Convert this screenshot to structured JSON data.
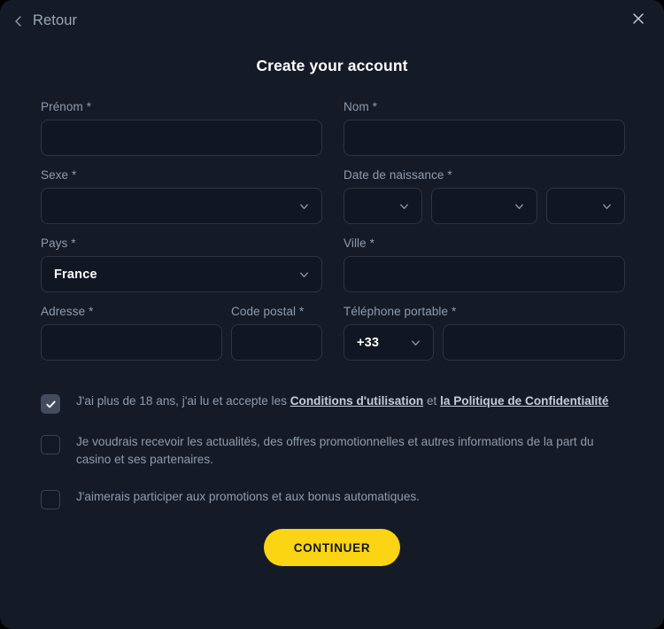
{
  "header": {
    "back_label": "Retour",
    "close_icon": "close-icon",
    "back_icon": "chevron-left-icon",
    "title": "Create your account"
  },
  "form": {
    "first_name": {
      "label": "Prénom *",
      "value": "",
      "placeholder": ""
    },
    "last_name": {
      "label": "Nom *",
      "value": "",
      "placeholder": ""
    },
    "sex": {
      "label": "Sexe *",
      "value": ""
    },
    "birth_date": {
      "label": "Date de naissance *",
      "day": "",
      "month": "",
      "year": ""
    },
    "country": {
      "label": "Pays *",
      "value": "France"
    },
    "city": {
      "label": "Ville *",
      "value": "",
      "placeholder": ""
    },
    "address": {
      "label": "Adresse *",
      "value": "",
      "placeholder": ""
    },
    "postal_code": {
      "label": "Code postal *",
      "value": "",
      "placeholder": ""
    },
    "mobile_phone": {
      "label": "Téléphone portable *",
      "prefix": "+33",
      "number": "",
      "placeholder": ""
    }
  },
  "consents": [
    {
      "checked": true,
      "text_before": "J'ai plus de 18 ans, j'ai lu et accepte les ",
      "link1": "Conditions d'utilisation",
      "text_middle": " et ",
      "link2": "la Politique de Confidentialité",
      "text_after": ""
    },
    {
      "checked": false,
      "text": "Je voudrais recevoir les actualités, des offres promotionnelles et autres informations de la part du casino et ses partenaires."
    },
    {
      "checked": false,
      "text": "J'aimerais participer aux promotions et aux bonus automatiques."
    }
  ],
  "footer": {
    "continue_label": "CONTINUER"
  },
  "colors": {
    "panel_background": "#151b26",
    "field_background": "#111722",
    "field_border": "#2c3442",
    "label_text": "#8e9bad",
    "accent_button": "#fbd413",
    "button_text": "#121722",
    "title_text": "#ffffff",
    "link_text": "#c3ccd8",
    "checkbox_checked": "#424c5c"
  }
}
